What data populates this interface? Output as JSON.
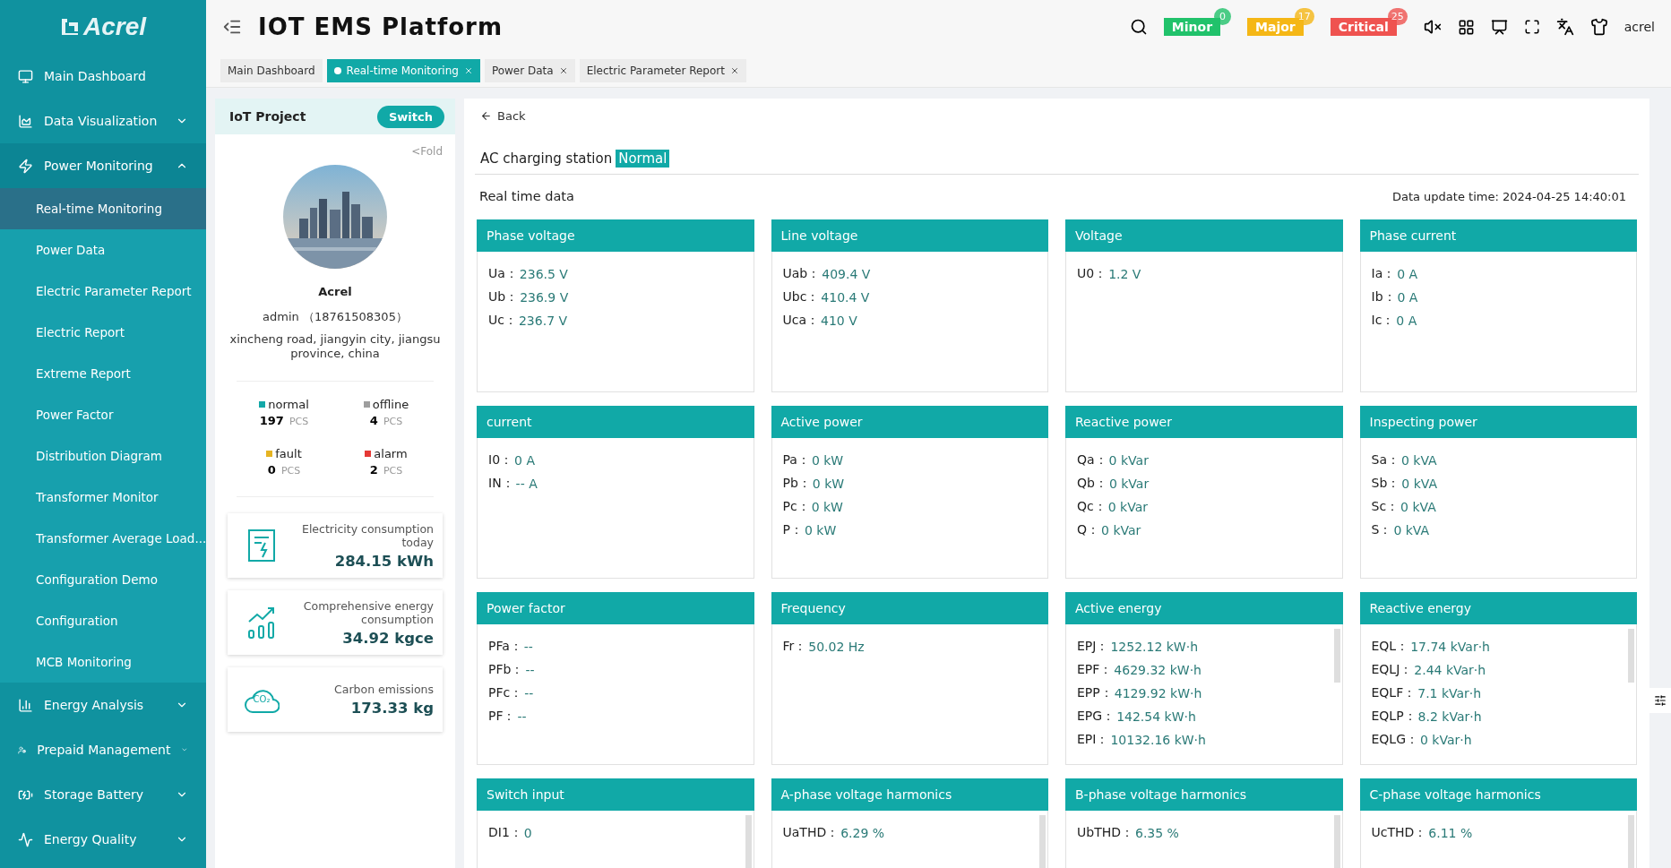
{
  "sidebar": {
    "logo": "Acrel",
    "items": [
      {
        "label": "Main Dashboard"
      },
      {
        "label": "Data Visualization",
        "expanded": false
      },
      {
        "label": "Power Monitoring",
        "expanded": true,
        "children": [
          {
            "label": "Real-time Monitoring",
            "selected": true
          },
          {
            "label": "Power Data",
            "selected": false
          },
          {
            "label": "Electric Parameter Report",
            "selected": false
          },
          {
            "label": "Electric Report",
            "selected": false
          },
          {
            "label": "Extreme Report",
            "selected": false
          },
          {
            "label": "Power Factor",
            "selected": false
          },
          {
            "label": "Distribution Diagram",
            "selected": false
          },
          {
            "label": "Transformer Monitor",
            "selected": false
          },
          {
            "label": "Transformer Average Load...",
            "selected": false
          },
          {
            "label": "Configuration Demo",
            "selected": false
          },
          {
            "label": "Configuration",
            "selected": false
          },
          {
            "label": "MCB Monitoring",
            "selected": false
          }
        ]
      },
      {
        "label": "Energy Analysis",
        "expanded": false
      },
      {
        "label": "Prepaid Management",
        "expanded": false
      },
      {
        "label": "Storage Battery",
        "expanded": false
      },
      {
        "label": "Energy Quality",
        "expanded": false
      }
    ]
  },
  "header": {
    "title": "IOT EMS Platform",
    "alarms": [
      {
        "label": "Minor",
        "count": "0",
        "color": "#21c26b"
      },
      {
        "label": "Major",
        "count": "17",
        "color": "#f5b716"
      },
      {
        "label": "Critical",
        "count": "25",
        "color": "#ef5350"
      }
    ],
    "user": "acrel"
  },
  "tabs": [
    {
      "label": "Main Dashboard",
      "selected": false,
      "closable": false
    },
    {
      "label": "Real-time Monitoring",
      "selected": true,
      "closable": true
    },
    {
      "label": "Power Data",
      "selected": false,
      "closable": true
    },
    {
      "label": "Electric Parameter Report",
      "selected": false,
      "closable": true
    }
  ],
  "project": {
    "title": "IoT Project",
    "switch": "Switch",
    "fold": "<Fold",
    "name": "Acrel",
    "admin": "admin （18761508305）",
    "address": "xincheng road, jiangyin city, jiangsu province, china",
    "statuses": [
      {
        "label": "normal",
        "count": "197",
        "unit": "PCS",
        "color": "#13a8a8"
      },
      {
        "label": "offline",
        "count": "4",
        "unit": "PCS",
        "color": "#9e9e9e"
      },
      {
        "label": "fault",
        "count": "0",
        "unit": "PCS",
        "color": "#e6b422"
      },
      {
        "label": "alarm",
        "count": "2",
        "unit": "PCS",
        "color": "#e53935"
      }
    ],
    "stats": [
      {
        "kind": "electricity",
        "label": "Electricity consumption today",
        "value": "284.15 kWh"
      },
      {
        "kind": "energy",
        "label": "Comprehensive energy consumption",
        "value": "34.92 kgce"
      },
      {
        "kind": "carbon",
        "label": "Carbon emissions",
        "value": "173.33 kg",
        "icon_text": "CO₂"
      }
    ]
  },
  "detail": {
    "back": "Back",
    "device": "AC charging station",
    "status": "Normal",
    "section": "Real time data",
    "update_time": "Data update time: 2024-04-25 14:40:01",
    "cards": [
      {
        "title": "Phase voltage",
        "scrollable": false,
        "rows": [
          {
            "label": "Ua：",
            "value": "236.5 V"
          },
          {
            "label": "Ub：",
            "value": "236.9 V"
          },
          {
            "label": "Uc：",
            "value": "236.7 V"
          }
        ]
      },
      {
        "title": "Line voltage",
        "scrollable": false,
        "rows": [
          {
            "label": "Uab：",
            "value": "409.4 V"
          },
          {
            "label": "Ubc：",
            "value": "410.4 V"
          },
          {
            "label": "Uca：",
            "value": "410 V"
          }
        ]
      },
      {
        "title": "Voltage",
        "scrollable": false,
        "rows": [
          {
            "label": "U0：",
            "value": "1.2 V"
          }
        ]
      },
      {
        "title": "Phase current",
        "scrollable": false,
        "rows": [
          {
            "label": "Ia：",
            "value": "0 A"
          },
          {
            "label": "Ib：",
            "value": "0 A"
          },
          {
            "label": "Ic：",
            "value": "0 A"
          }
        ]
      },
      {
        "title": "current",
        "scrollable": false,
        "rows": [
          {
            "label": "I0：",
            "value": "0 A"
          },
          {
            "label": "IN：",
            "value": "-- A"
          }
        ]
      },
      {
        "title": "Active power",
        "scrollable": false,
        "rows": [
          {
            "label": "Pa：",
            "value": "0 kW"
          },
          {
            "label": "Pb：",
            "value": "0 kW"
          },
          {
            "label": "Pc：",
            "value": "0 kW"
          },
          {
            "label": "P：",
            "value": "0 kW"
          }
        ]
      },
      {
        "title": "Reactive power",
        "scrollable": false,
        "rows": [
          {
            "label": "Qa：",
            "value": "0 kVar"
          },
          {
            "label": "Qb：",
            "value": "0 kVar"
          },
          {
            "label": "Qc：",
            "value": "0 kVar"
          },
          {
            "label": "Q：",
            "value": "0 kVar"
          }
        ]
      },
      {
        "title": "Inspecting power",
        "scrollable": false,
        "rows": [
          {
            "label": "Sa：",
            "value": "0 kVA"
          },
          {
            "label": "Sb：",
            "value": "0 kVA"
          },
          {
            "label": "Sc：",
            "value": "0 kVA"
          },
          {
            "label": "S：",
            "value": "0 kVA"
          }
        ]
      },
      {
        "title": "Power factor",
        "scrollable": false,
        "rows": [
          {
            "label": "PFa：",
            "value": "--"
          },
          {
            "label": "PFb：",
            "value": "--"
          },
          {
            "label": "PFc：",
            "value": "--"
          },
          {
            "label": "PF：",
            "value": "--"
          }
        ]
      },
      {
        "title": "Frequency",
        "scrollable": false,
        "rows": [
          {
            "label": "Fr：",
            "value": "50.02 Hz"
          }
        ]
      },
      {
        "title": "Active energy",
        "scrollable": true,
        "rows": [
          {
            "label": "EPJ：",
            "value": "1252.12 kW·h"
          },
          {
            "label": "EPF：",
            "value": "4629.32 kW·h"
          },
          {
            "label": "EPP：",
            "value": "4129.92 kW·h"
          },
          {
            "label": "EPG：",
            "value": "142.54 kW·h"
          },
          {
            "label": "EPI：",
            "value": "10132.16 kW·h"
          }
        ]
      },
      {
        "title": "Reactive energy",
        "scrollable": true,
        "rows": [
          {
            "label": "EQL：",
            "value": "17.74 kVar·h"
          },
          {
            "label": "EQLJ：",
            "value": "2.44 kVar·h"
          },
          {
            "label": "EQLF：",
            "value": "7.1 kVar·h"
          },
          {
            "label": "EQLP：",
            "value": "8.2 kVar·h"
          },
          {
            "label": "EQLG：",
            "value": "0 kVar·h"
          }
        ]
      },
      {
        "title": "Switch input",
        "scrollable": true,
        "rows": [
          {
            "label": "DI1：",
            "value": "0"
          }
        ]
      },
      {
        "title": "A-phase voltage harmonics",
        "scrollable": true,
        "rows": [
          {
            "label": "UaTHD：",
            "value": "6.29 %"
          }
        ]
      },
      {
        "title": "B-phase voltage harmonics",
        "scrollable": true,
        "rows": [
          {
            "label": "UbTHD：",
            "value": "6.35 %"
          }
        ]
      },
      {
        "title": "C-phase voltage harmonics",
        "scrollable": true,
        "rows": [
          {
            "label": "UcTHD：",
            "value": "6.11 %"
          }
        ]
      }
    ]
  }
}
